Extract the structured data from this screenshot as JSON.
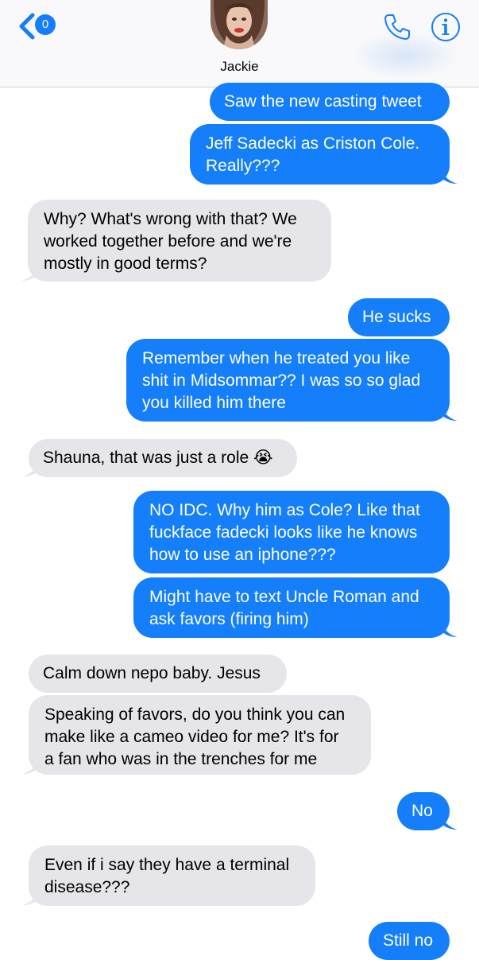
{
  "header": {
    "badge_count": "0",
    "contact_name": "Jackie"
  },
  "colors": {
    "sent": "#147efb",
    "received": "#e5e5ea",
    "accent": "#147efb"
  },
  "icons": [
    "chevron-left-icon",
    "phone-icon",
    "info-icon"
  ],
  "messages": [
    {
      "from": "me",
      "text": "Saw the new casting tweet"
    },
    {
      "from": "me",
      "text": "Jeff Sadecki as Criston Cole.\nReally???"
    },
    {
      "from": "them",
      "text": "Why? What's wrong with that? We\nworked together before and we're\nmostly in good terms?"
    },
    {
      "from": "me",
      "text": "He sucks"
    },
    {
      "from": "me",
      "text": "Remember when he treated you like\nshit in Midsommar?? I was so so glad\nyou killed him there"
    },
    {
      "from": "them",
      "text": "Shauna, that was just a role 😭"
    },
    {
      "from": "me",
      "text": "NO IDC. Why him as Cole? Like that\nfuckface fadecki looks like he knows\nhow to use an iphone???"
    },
    {
      "from": "me",
      "text": "Might have to text Uncle Roman and\nask favors (firing him)"
    },
    {
      "from": "them",
      "text": "Calm down nepo baby. Jesus"
    },
    {
      "from": "them",
      "text": "Speaking of favors, do you think you can\nmake like a cameo video for me? It's for\na fan who was in the trenches for me"
    },
    {
      "from": "me",
      "text": "No"
    },
    {
      "from": "them",
      "text": "Even if i say they have a terminal\ndisease???"
    },
    {
      "from": "me",
      "text": "Still no"
    }
  ]
}
